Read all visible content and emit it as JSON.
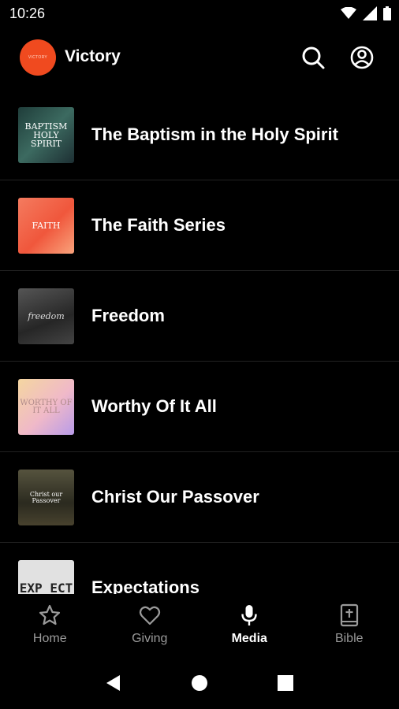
{
  "status": {
    "time": "10:26"
  },
  "header": {
    "title": "Victory",
    "logo_text": "VICTORY"
  },
  "series": [
    {
      "title": "The Baptism in the Holy Spirit",
      "thumb_text": "BAPTISM HOLY SPIRIT",
      "thumb_bg": "#2a4a44"
    },
    {
      "title": "The Faith Series",
      "thumb_text": "FAITH",
      "thumb_bg": "#f2634a"
    },
    {
      "title": "Freedom",
      "thumb_text": "freedom",
      "thumb_bg": "#3a3a3a"
    },
    {
      "title": "Worthy Of It All",
      "thumb_text": "WORTHY OF IT ALL",
      "thumb_bg": "#e9c9d4"
    },
    {
      "title": "Christ Our Passover",
      "thumb_text": "Christ our Passover",
      "thumb_bg": "#3d3a2a"
    },
    {
      "title": "Expectations",
      "thumb_text": "EXP ECT",
      "thumb_bg": "#d8d8d8"
    }
  ],
  "nav": {
    "items": [
      {
        "label": "Home",
        "icon": "star-icon"
      },
      {
        "label": "Giving",
        "icon": "heart-icon"
      },
      {
        "label": "Media",
        "icon": "microphone-icon"
      },
      {
        "label": "Bible",
        "icon": "bible-icon"
      }
    ],
    "active": "Media"
  }
}
